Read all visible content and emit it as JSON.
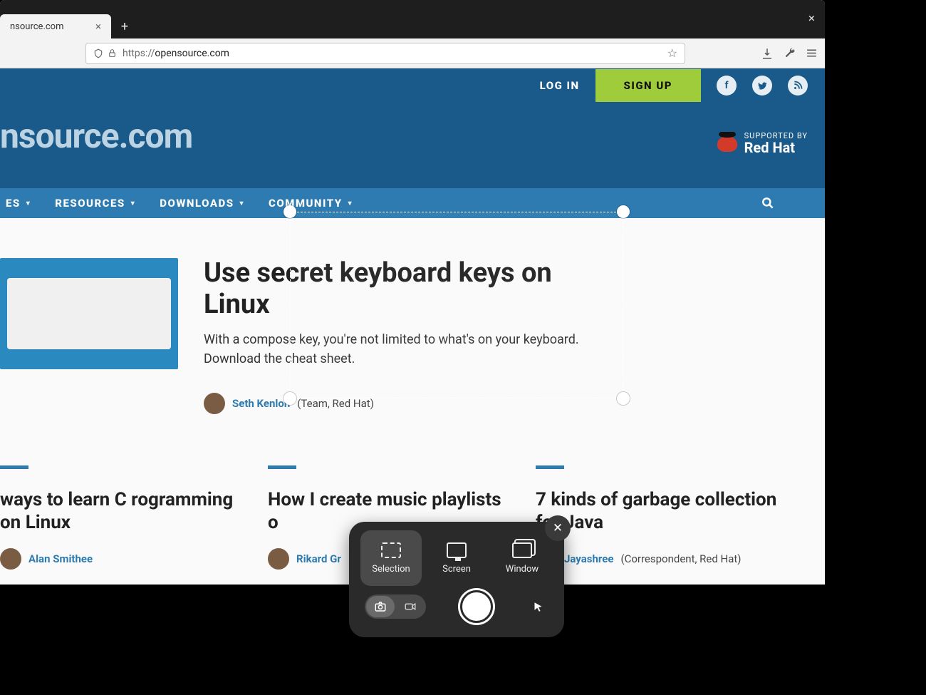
{
  "browser": {
    "tab_title": "nsource.com",
    "url_scheme": "https://",
    "url_host": "opensource.com",
    "sidebar_close_glyph": "×",
    "tab_close_glyph": "×",
    "new_tab_glyph": "+",
    "star_glyph": "☆",
    "download_glyph": "⬇",
    "wrench_glyph": "🔧",
    "menu_glyph": "≡"
  },
  "page": {
    "login_label": "LOG IN",
    "signup_label": "SIGN UP",
    "logo_text": "nsource.com",
    "supported_by": "SUPPORTED BY",
    "redhat_label": "Red Hat",
    "nav": [
      {
        "label": "ES"
      },
      {
        "label": "RESOURCES"
      },
      {
        "label": "DOWNLOADS"
      },
      {
        "label": "COMMUNITY"
      }
    ],
    "hero": {
      "title": "Use secret keyboard keys on Linux",
      "subtitle": "With a compose key, you're not limited to what's on your keyboard. Download the cheat sheet.",
      "author_name": "Seth Kenlon",
      "author_role": "(Team, Red Hat)"
    },
    "cards": [
      {
        "title": "ways to learn C rogramming on Linux",
        "author_name": "Alan Smithee",
        "author_role": ""
      },
      {
        "title": "How I create music playlists o",
        "author_name": "Rikard Gr",
        "author_role": ""
      },
      {
        "title": "7 kinds of garbage collection for Java",
        "author_name": "Jayashree",
        "author_role": "(Correspondent, Red Hat)"
      }
    ]
  },
  "screenshot_ui": {
    "close_glyph": "✕",
    "modes": {
      "selection": "Selection",
      "screen": "Screen",
      "window": "Window"
    },
    "pointer_glyph": "➤"
  }
}
